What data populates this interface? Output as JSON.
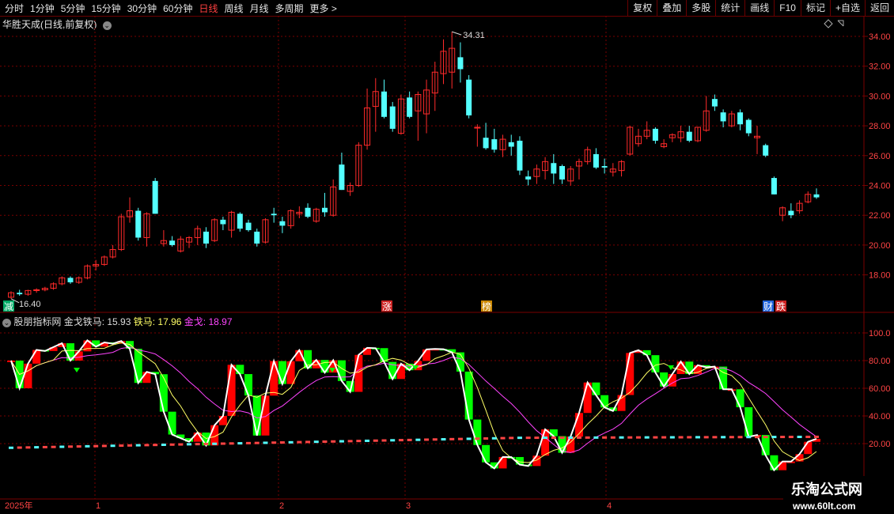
{
  "toolbar": {
    "periods": [
      "分时",
      "1分钟",
      "5分钟",
      "15分钟",
      "30分钟",
      "60分钟",
      "日线",
      "周线",
      "月线",
      "多周期",
      "更多 >"
    ],
    "active": "日线",
    "right_buttons": [
      "复权",
      "叠加",
      "多股",
      "统计",
      "画线",
      "F10",
      "标记",
      "+自选",
      "返回"
    ]
  },
  "header": {
    "stock_name": "华胜天成(日线,前复权)",
    "dropdown_icon": "chevron-down-icon",
    "diamond_icon": "diamond-icon",
    "expand_icon": "expand-icon"
  },
  "price_chart": {
    "y_ticks": [
      "34.00",
      "32.00",
      "30.00",
      "28.00",
      "26.00",
      "24.00",
      "22.00",
      "20.00",
      "18.00"
    ],
    "high_label": "34.31",
    "low_label": "16.40",
    "markers": [
      "减",
      "涨",
      "榜",
      "财",
      "跌"
    ]
  },
  "indicator": {
    "name": "股朋指标网",
    "label1": "金戈铁马: 15.93",
    "label2": "铁马: 17.96",
    "label3": "金戈: 18.97",
    "y_ticks": [
      "100.0",
      "80.00",
      "60.00",
      "40.00",
      "20.00"
    ]
  },
  "x_axis": {
    "labels": [
      "2025年",
      "1",
      "2",
      "3",
      "4"
    ]
  },
  "watermark": {
    "title": "乐淘公式网",
    "url": "www.60lt.com"
  },
  "colors": {
    "up": "#ff2a2a",
    "down": "#54ffff",
    "grid": "#7a0000",
    "ind_up": "#ff0000",
    "ind_down": "#00ff00",
    "iron": "#ffff66",
    "gold": "#ff44ff",
    "base": "#ff4444"
  },
  "chart_data": {
    "type": "candlestick",
    "candles": [
      [
        16.5,
        16.9,
        16.4,
        16.8
      ],
      [
        16.8,
        17.0,
        16.6,
        16.7
      ],
      [
        16.7,
        17.0,
        16.6,
        16.95
      ],
      [
        16.95,
        17.1,
        16.8,
        17.0
      ],
      [
        17.0,
        17.2,
        16.9,
        17.1
      ],
      [
        17.1,
        17.5,
        17.0,
        17.4
      ],
      [
        17.4,
        17.9,
        17.3,
        17.8
      ],
      [
        17.8,
        17.9,
        17.4,
        17.5
      ],
      [
        17.5,
        17.9,
        17.4,
        17.8
      ],
      [
        17.8,
        18.7,
        17.7,
        18.6
      ],
      [
        18.6,
        19.0,
        18.3,
        18.7
      ],
      [
        18.7,
        19.3,
        18.6,
        19.2
      ],
      [
        19.2,
        20.0,
        19.1,
        19.7
      ],
      [
        19.7,
        22.1,
        19.6,
        21.9
      ],
      [
        21.9,
        23.2,
        21.5,
        22.3
      ],
      [
        22.3,
        22.5,
        20.3,
        20.5
      ],
      [
        20.5,
        22.2,
        19.9,
        22.1
      ],
      [
        24.3,
        24.5,
        22.1,
        22.1
      ],
      [
        20.1,
        21.0,
        19.9,
        20.3
      ],
      [
        20.3,
        20.6,
        19.9,
        20.0
      ],
      [
        19.6,
        20.6,
        19.5,
        20.4
      ],
      [
        20.2,
        20.6,
        19.8,
        20.5
      ],
      [
        20.5,
        21.3,
        20.0,
        21.1
      ],
      [
        20.9,
        21.2,
        19.8,
        20.1
      ],
      [
        20.3,
        21.8,
        20.2,
        21.7
      ],
      [
        21.7,
        21.9,
        21.0,
        21.4
      ],
      [
        21.0,
        22.3,
        20.5,
        22.2
      ],
      [
        22.1,
        22.2,
        20.9,
        21.1
      ],
      [
        21.5,
        21.7,
        20.9,
        21.0
      ],
      [
        20.9,
        21.1,
        19.9,
        20.1
      ],
      [
        20.2,
        21.8,
        20.1,
        21.7
      ],
      [
        22.1,
        22.5,
        21.5,
        22.0
      ],
      [
        21.6,
        21.9,
        20.8,
        21.3
      ],
      [
        21.3,
        22.4,
        21.1,
        22.3
      ],
      [
        22.1,
        22.6,
        21.8,
        22.2
      ],
      [
        22.5,
        22.8,
        21.8,
        21.9
      ],
      [
        21.6,
        22.5,
        21.5,
        22.4
      ],
      [
        22.5,
        23.5,
        21.9,
        22.2
      ],
      [
        22.0,
        24.4,
        21.9,
        23.9
      ],
      [
        25.4,
        26.2,
        23.7,
        23.7
      ],
      [
        23.6,
        24.2,
        23.3,
        24.0
      ],
      [
        24.0,
        26.9,
        23.9,
        26.7
      ],
      [
        26.7,
        30.5,
        26.4,
        29.2
      ],
      [
        29.3,
        31.2,
        27.6,
        30.3
      ],
      [
        30.3,
        31.1,
        28.5,
        28.6
      ],
      [
        29.3,
        29.6,
        27.6,
        27.8
      ],
      [
        27.5,
        30.1,
        27.4,
        29.8
      ],
      [
        29.9,
        30.3,
        28.5,
        28.6
      ],
      [
        29.0,
        30.3,
        27.0,
        30.1
      ],
      [
        28.8,
        31.1,
        27.5,
        30.4
      ],
      [
        30.2,
        32.3,
        29.0,
        31.6
      ],
      [
        31.5,
        33.8,
        30.8,
        33.0
      ],
      [
        31.6,
        34.31,
        30.5,
        33.2
      ],
      [
        32.6,
        33.6,
        30.9,
        31.8
      ],
      [
        31.1,
        31.4,
        28.5,
        28.7
      ],
      [
        27.9,
        28.1,
        26.6,
        27.9
      ],
      [
        27.2,
        28.2,
        26.4,
        26.5
      ],
      [
        27.1,
        27.8,
        26.2,
        26.4
      ],
      [
        26.4,
        27.4,
        25.9,
        27.1
      ],
      [
        26.9,
        27.4,
        26.0,
        26.6
      ],
      [
        27.0,
        27.3,
        24.7,
        25.0
      ],
      [
        24.6,
        25.0,
        24.0,
        24.4
      ],
      [
        24.6,
        25.4,
        24.1,
        25.1
      ],
      [
        25.0,
        25.9,
        24.4,
        25.6
      ],
      [
        25.5,
        26.1,
        24.1,
        24.8
      ],
      [
        25.3,
        25.4,
        24.1,
        24.4
      ],
      [
        24.3,
        25.3,
        24.0,
        25.1
      ],
      [
        25.3,
        25.8,
        24.4,
        25.6
      ],
      [
        25.6,
        26.6,
        25.4,
        26.4
      ],
      [
        26.1,
        26.5,
        25.1,
        25.2
      ],
      [
        25.3,
        25.8,
        24.8,
        25.2
      ],
      [
        24.9,
        25.5,
        24.6,
        25.1
      ],
      [
        25.0,
        25.7,
        24.6,
        25.6
      ],
      [
        26.1,
        28.0,
        26.0,
        27.9
      ],
      [
        26.8,
        27.8,
        26.6,
        27.3
      ],
      [
        27.3,
        28.3,
        27.1,
        27.7
      ],
      [
        27.8,
        27.9,
        26.8,
        27.0
      ],
      [
        26.6,
        27.1,
        26.5,
        26.8
      ],
      [
        27.2,
        27.5,
        26.9,
        27.4
      ],
      [
        27.2,
        28.0,
        26.9,
        27.6
      ],
      [
        27.6,
        28.0,
        26.9,
        27.0
      ],
      [
        27.0,
        27.9,
        26.9,
        27.9
      ],
      [
        27.7,
        30.0,
        27.6,
        29.0
      ],
      [
        29.8,
        30.1,
        29.0,
        29.3
      ],
      [
        28.9,
        29.1,
        27.9,
        28.3
      ],
      [
        28.0,
        29.0,
        27.9,
        28.8
      ],
      [
        28.9,
        29.1,
        27.7,
        28.1
      ],
      [
        28.4,
        28.5,
        27.3,
        27.5
      ],
      [
        27.2,
        28.0,
        26.1,
        27.3
      ],
      [
        26.7,
        26.8,
        25.9,
        26.0
      ],
      [
        24.5,
        24.6,
        23.4,
        23.4
      ],
      [
        22.0,
        22.6,
        21.6,
        22.5
      ],
      [
        22.3,
        22.8,
        21.8,
        22.0
      ],
      [
        22.3,
        23.0,
        22.1,
        22.8
      ],
      [
        22.9,
        23.6,
        22.8,
        23.4
      ],
      [
        23.4,
        23.8,
        23.1,
        23.2
      ]
    ],
    "ylim": [
      16.0,
      35.0
    ],
    "indicator_ylim": [
      0,
      110
    ],
    "indicator_values": {
      "jingetiema": 15.93,
      "tiema": 17.96,
      "jinge": 18.97
    }
  }
}
